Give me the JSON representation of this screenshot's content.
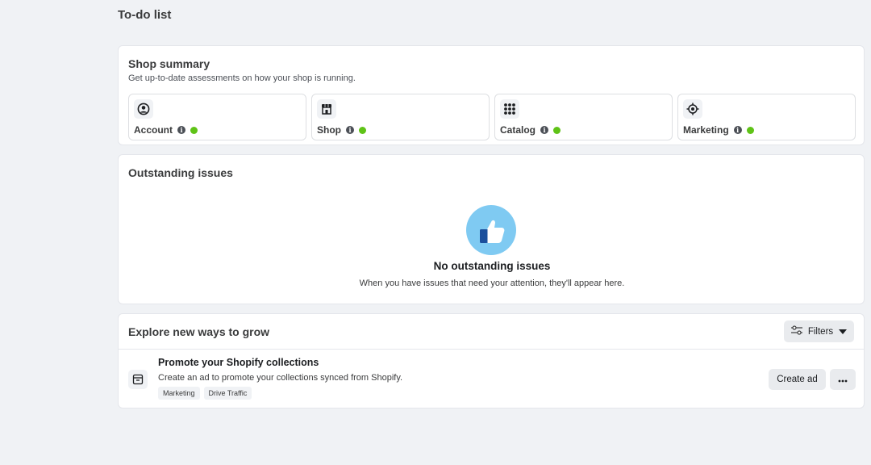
{
  "page": {
    "title": "To-do list"
  },
  "shop_summary": {
    "title": "Shop summary",
    "subtitle": "Get up-to-date assessments on how your shop is running.",
    "tiles": [
      {
        "label": "Account",
        "icon": "account-icon",
        "status": "green"
      },
      {
        "label": "Shop",
        "icon": "storefront-icon",
        "status": "green"
      },
      {
        "label": "Catalog",
        "icon": "grid-icon",
        "status": "green"
      },
      {
        "label": "Marketing",
        "icon": "target-icon",
        "status": "green"
      }
    ],
    "status_color": "#5fc317"
  },
  "issues": {
    "title": "Outstanding issues",
    "empty_title": "No outstanding issues",
    "empty_subtitle": "When you have issues that need your attention, they'll appear here.",
    "icon": "thumbs-up-icon"
  },
  "explore": {
    "title": "Explore new ways to grow",
    "filters_label": "Filters",
    "items": [
      {
        "title": "Promote your Shopify collections",
        "description": "Create an ad to promote your collections synced from Shopify.",
        "tags": [
          "Marketing",
          "Drive Traffic"
        ],
        "action_label": "Create ad",
        "icon": "collection-icon"
      }
    ]
  }
}
